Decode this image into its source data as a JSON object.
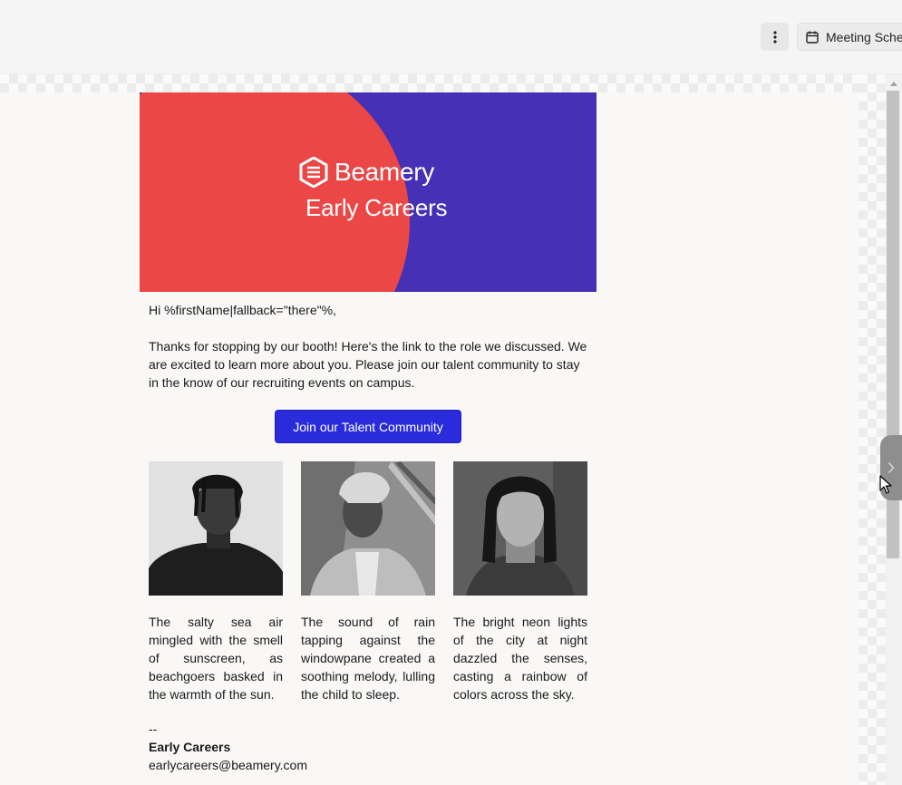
{
  "toolbar": {
    "more_icon": "vertical-dots-icon",
    "meeting_icon": "calendar-icon",
    "meeting_label": "Meeting Scheduler"
  },
  "email": {
    "banner": {
      "brand": "Beamery",
      "subtitle": "Early Careers",
      "colors": {
        "background": "#4530b6",
        "accent": "#eb4747"
      }
    },
    "greeting": "Hi %firstName|fallback=\"there\"%,",
    "body": "Thanks for stopping by our booth! Here's the link to the role we discussed. We are excited to learn more about you. Please join our talent community to stay in the know of our recruiting events on campus.",
    "cta_label": "Join our Talent Community",
    "cta_color": "#2a2cdc",
    "columns": [
      {
        "caption": "The salty sea air mingled with the smell of sunscreen, as beachgoers basked in the warmth of the sun."
      },
      {
        "caption": "The sound of rain tapping against the windowpane created a soothing melody, lulling the child to sleep."
      },
      {
        "caption": "The bright neon lights of the city at night dazzled the senses, casting a rainbow of colors across the sky."
      }
    ],
    "signature": {
      "dashes": "--",
      "name": "Early Careers",
      "email": "earlycareers@beamery.com"
    }
  }
}
